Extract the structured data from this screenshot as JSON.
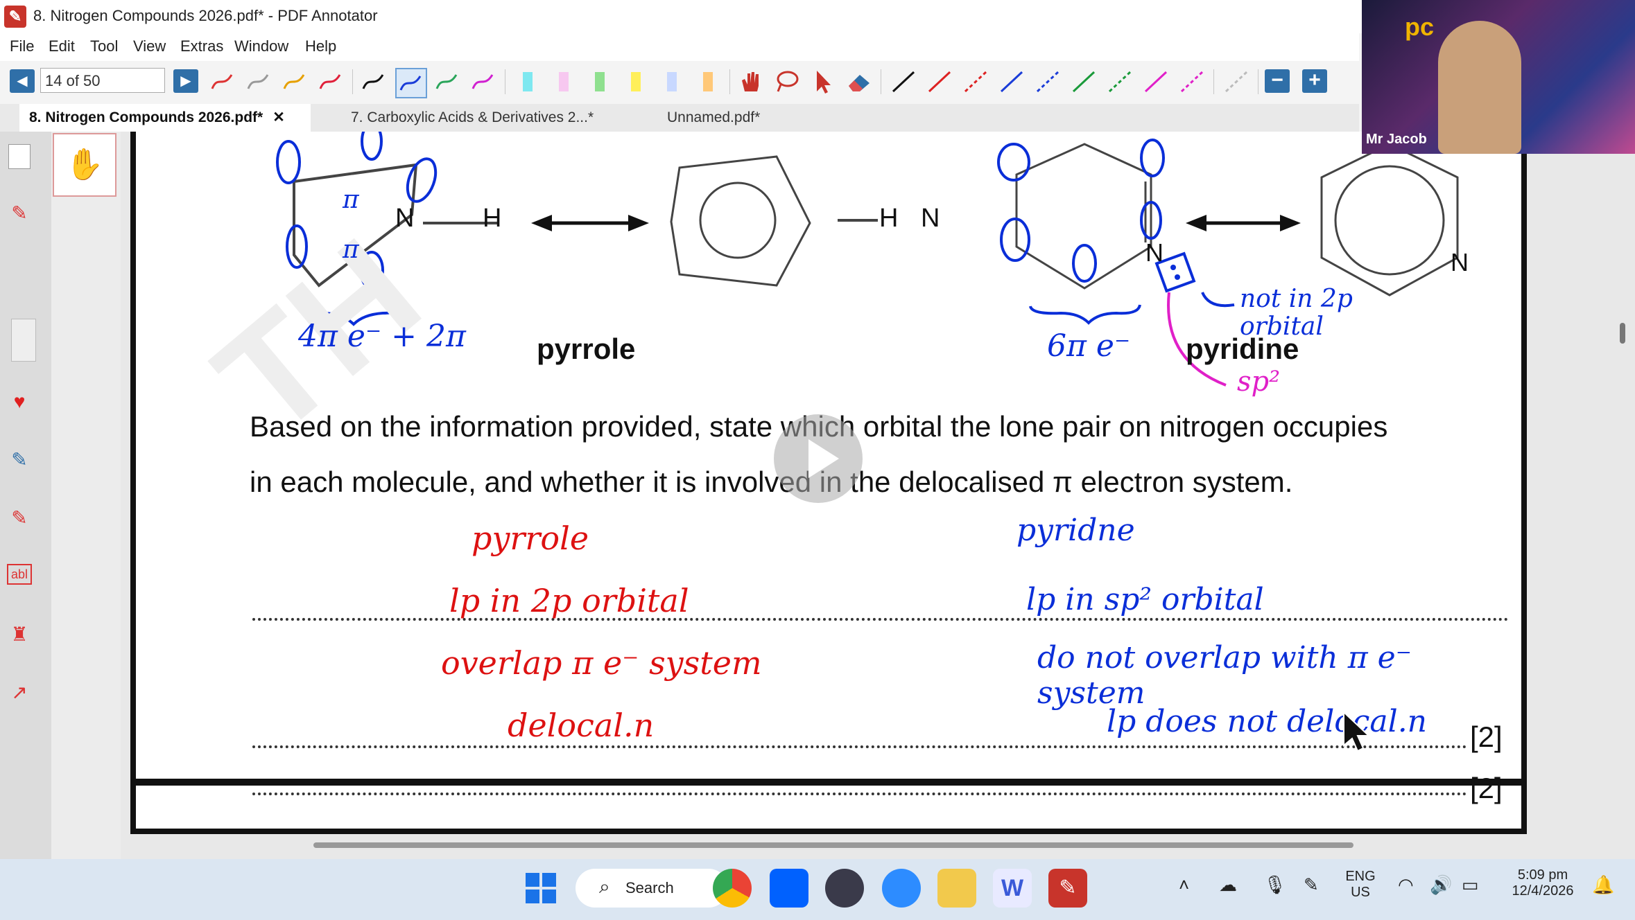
{
  "window": {
    "title": "8. Nitrogen Compounds 2026.pdf* - PDF Annotator"
  },
  "menu": [
    "File",
    "Edit",
    "Tool",
    "View",
    "Extras",
    "Window",
    "Help"
  ],
  "toolbar": {
    "page_indicator": "14 of 50",
    "prev_icon": "triangle-left-icon",
    "next_icon": "triangle-right-icon",
    "zoom_out": "−",
    "zoom_in": "+"
  },
  "tabs": [
    {
      "label": "8. Nitrogen Compounds 2026.pdf*",
      "active": true,
      "close": "✕"
    },
    {
      "label": "7. Carboxylic Acids & Derivatives 2...*",
      "active": false
    },
    {
      "label": "Unnamed.pdf*",
      "active": false
    }
  ],
  "webcam": {
    "participant_name": "Mr Jacob",
    "logo_text": "pc"
  },
  "document": {
    "pyrrole_label": "pyrrole",
    "pyridine_label": "pyridine",
    "atom_N": "N",
    "atom_H": "H",
    "question_line1": "Based on the information provided, state which orbital the lone pair on nitrogen occupies",
    "question_line2": "in each molecule, and whether it is involved in the delocalised π electron system.",
    "marks": "[2]",
    "marks_next": "[2]"
  },
  "annotations": {
    "pyrrole_pi_1": "π",
    "pyrrole_pi_2": "π",
    "pyrrole_count": "4π e⁻ + 2π",
    "pyridine_count": "6π e⁻",
    "pyridine_note": "not in 2p orbital",
    "pyridine_hybrid": "sp²",
    "red_heading": "pyrrole",
    "red_line1": "lp in 2p orbital",
    "red_line2": "overlap π e⁻ system",
    "red_line3": "delocal.n",
    "blue_heading": "pyridne",
    "blue_line1": "lp in sp² orbital",
    "blue_line2": "do not overlap with π e⁻ system",
    "blue_line3": "lp does not delocal.n"
  },
  "taskbar": {
    "search_label": "Search",
    "lang_line1": "ENG",
    "lang_line2": "US",
    "time": "5:09 pm",
    "date": "12/4/2026"
  },
  "colors": {
    "accent_blue": "#2f6fa8",
    "ink_red": "#dd1111",
    "ink_blue": "#0a2ed8",
    "ink_pink": "#e020c8"
  }
}
